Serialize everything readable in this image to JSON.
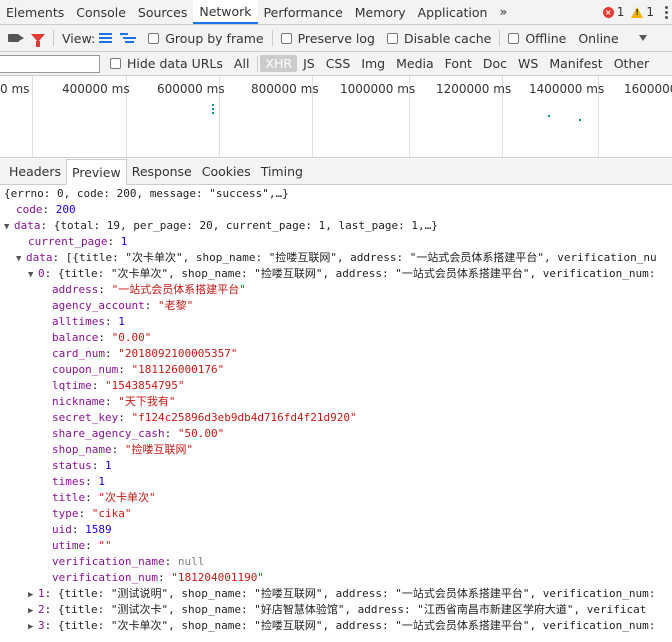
{
  "tabs": [
    "Elements",
    "Console",
    "Sources",
    "Network",
    "Performance",
    "Memory",
    "Application"
  ],
  "active_tab": "Network",
  "more_tabs": "»",
  "errors_count": "1",
  "warnings_count": "1",
  "toolbar": {
    "view_label": "View:",
    "group_by_frame": "Group by frame",
    "preserve_log": "Preserve log",
    "disable_cache": "Disable cache",
    "offline": "Offline",
    "online": "Online"
  },
  "filter": {
    "hide_data_urls": "Hide data URLs",
    "types": [
      "All",
      "XHR",
      "JS",
      "CSS",
      "Img",
      "Media",
      "Font",
      "Doc",
      "WS",
      "Manifest",
      "Other"
    ],
    "active_type": "XHR"
  },
  "overview_ticks": [
    "0 ms",
    "400000 ms",
    "600000 ms",
    "800000 ms",
    "1000000 ms",
    "1200000 ms",
    "1400000 ms",
    "1600000"
  ],
  "detail_tabs": [
    "Headers",
    "Preview",
    "Response",
    "Cookies",
    "Timing"
  ],
  "active_detail_tab": "Preview",
  "json": {
    "root_summary": "{errno: 0, code: 200, message: \"success\",…}",
    "code_key": "code",
    "code_val": "200",
    "data_key": "data",
    "data_summary": "{total: 19, per_page: 20, current_page: 1, last_page: 1,…}",
    "current_page_key": "current_page",
    "current_page_val": "1",
    "data_arr_key": "data",
    "data_arr_summary": "[{title: \"次卡单次\", shop_name: \"捡喽互联网\", address: \"一站式会员体系搭建平台\", verification_nu",
    "item0_key": "0",
    "item0_summary": "{title: \"次卡单次\", shop_name: \"捡喽互联网\", address: \"一站式会员体系搭建平台\", verification_num:",
    "fields": [
      {
        "k": "address",
        "v": "\"一站式会员体系搭建平台\"",
        "t": "s"
      },
      {
        "k": "agency_account",
        "v": "\"老黎\"",
        "t": "s"
      },
      {
        "k": "alltimes",
        "v": "1",
        "t": "n"
      },
      {
        "k": "balance",
        "v": "\"0.00\"",
        "t": "s"
      },
      {
        "k": "card_num",
        "v": "\"2018092100005357\"",
        "t": "s"
      },
      {
        "k": "coupon_num",
        "v": "\"181126000176\"",
        "t": "s"
      },
      {
        "k": "lqtime",
        "v": "\"1543854795\"",
        "t": "s"
      },
      {
        "k": "nickname",
        "v": "\"天下我有\"",
        "t": "s"
      },
      {
        "k": "secret_key",
        "v": "\"f124c25896d3eb9db4d716fd4f21d920\"",
        "t": "s"
      },
      {
        "k": "share_agency_cash",
        "v": "\"50.00\"",
        "t": "s"
      },
      {
        "k": "shop_name",
        "v": "\"捡喽互联网\"",
        "t": "s"
      },
      {
        "k": "status",
        "v": "1",
        "t": "n"
      },
      {
        "k": "times",
        "v": "1",
        "t": "n"
      },
      {
        "k": "title",
        "v": "\"次卡单次\"",
        "t": "s"
      },
      {
        "k": "type",
        "v": "\"cika\"",
        "t": "s"
      },
      {
        "k": "uid",
        "v": "1589",
        "t": "n"
      },
      {
        "k": "utime",
        "v": "\"\"",
        "t": "s"
      },
      {
        "k": "verification_name",
        "v": "null",
        "t": "nl"
      },
      {
        "k": "verification_num",
        "v": "\"181204001190\"",
        "t": "s"
      }
    ],
    "collapsed_items": [
      {
        "k": "1",
        "summary": "{title: \"测试说明\", shop_name: \"捡喽互联网\", address: \"一站式会员体系搭建平台\", verification_num:"
      },
      {
        "k": "2",
        "summary": "{title: \"测试次卡\", shop_name: \"好店智慧体验馆\", address: \"江西省南昌市新建区学府大道\", verificat"
      },
      {
        "k": "3",
        "summary": "{title: \"次卡单次\", shop_name: \"捡喽互联网\", address: \"一站式会员体系搭建平台\", verification_num:"
      }
    ]
  },
  "colors": {
    "key": "#881391",
    "string": "#c41a16",
    "number": "#1c00cf",
    "accent": "#1a73e8",
    "error": "#e53935"
  }
}
